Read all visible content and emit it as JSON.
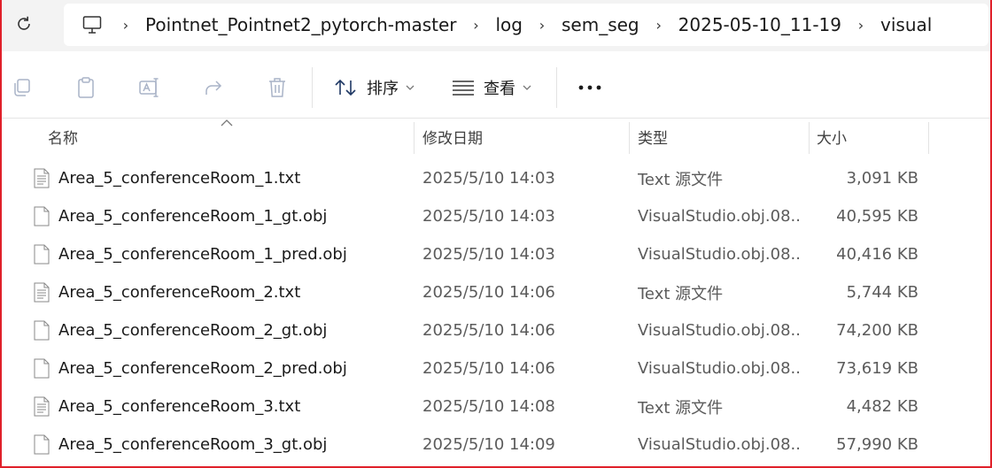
{
  "address": {
    "crumbs": [
      "Pointnet_Pointnet2_pytorch-master",
      "log",
      "sem_seg",
      "2025-05-10_11-19",
      "visual"
    ]
  },
  "toolbar": {
    "sort_label": "排序",
    "view_label": "查看"
  },
  "columns": {
    "name": "名称",
    "date": "修改日期",
    "type": "类型",
    "size": "大小"
  },
  "files": [
    {
      "name": "Area_5_conferenceRoom_1.txt",
      "date": "2025/5/10 14:03",
      "type": "Text 源文件",
      "size": "3,091 KB",
      "icon": "text-file-icon"
    },
    {
      "name": "Area_5_conferenceRoom_1_gt.obj",
      "date": "2025/5/10 14:03",
      "type": "VisualStudio.obj.08...",
      "size": "40,595 KB",
      "icon": "blank-file-icon"
    },
    {
      "name": "Area_5_conferenceRoom_1_pred.obj",
      "date": "2025/5/10 14:03",
      "type": "VisualStudio.obj.08...",
      "size": "40,416 KB",
      "icon": "blank-file-icon"
    },
    {
      "name": "Area_5_conferenceRoom_2.txt",
      "date": "2025/5/10 14:06",
      "type": "Text 源文件",
      "size": "5,744 KB",
      "icon": "text-file-icon"
    },
    {
      "name": "Area_5_conferenceRoom_2_gt.obj",
      "date": "2025/5/10 14:06",
      "type": "VisualStudio.obj.08...",
      "size": "74,200 KB",
      "icon": "blank-file-icon"
    },
    {
      "name": "Area_5_conferenceRoom_2_pred.obj",
      "date": "2025/5/10 14:06",
      "type": "VisualStudio.obj.08...",
      "size": "73,619 KB",
      "icon": "blank-file-icon"
    },
    {
      "name": "Area_5_conferenceRoom_3.txt",
      "date": "2025/5/10 14:08",
      "type": "Text 源文件",
      "size": "4,482 KB",
      "icon": "text-file-icon"
    },
    {
      "name": "Area_5_conferenceRoom_3_gt.obj",
      "date": "2025/5/10 14:09",
      "type": "VisualStudio.obj.08...",
      "size": "57,990 KB",
      "icon": "blank-file-icon"
    }
  ],
  "colors": {
    "frame_border": "#e0202a",
    "disabled_icon": "#a9b3c7"
  }
}
